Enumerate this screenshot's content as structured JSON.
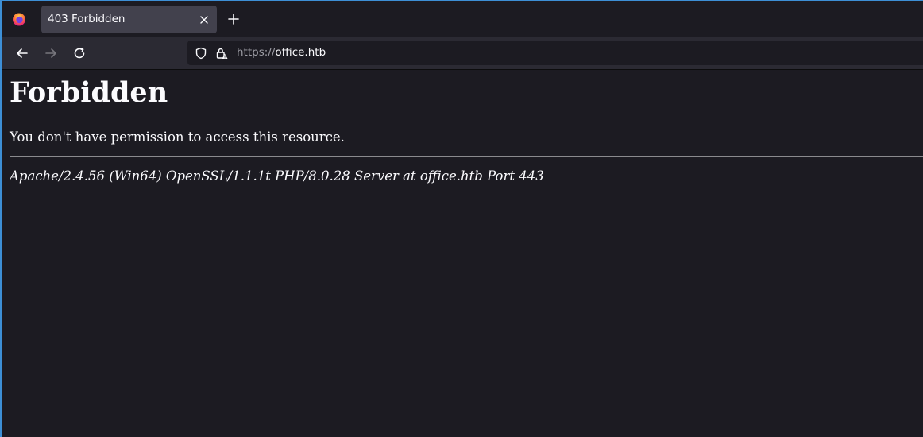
{
  "browser": {
    "tab": {
      "title": "403 Forbidden",
      "close_icon": "close-icon"
    },
    "new_tab_icon": "plus-icon",
    "nav": {
      "back_icon": "arrow-left-icon",
      "forward_icon": "arrow-right-icon",
      "reload_icon": "reload-icon"
    },
    "urlbar": {
      "scheme": "https://",
      "host": "office.htb",
      "shield_icon": "shield-icon",
      "lock_icon": "lock-warning-icon"
    }
  },
  "page": {
    "heading": "Forbidden",
    "message": "You don't have permission to access this resource.",
    "server_signature": "Apache/2.4.56 (Win64) OpenSSL/1.1.1t PHP/8.0.28 Server at office.htb Port 443"
  },
  "colors": {
    "window_border": "#3d8fd6",
    "background": "#1c1b22",
    "toolbar": "#2b2a33",
    "active_tab": "#42414d",
    "text": "#fbfbfe"
  }
}
